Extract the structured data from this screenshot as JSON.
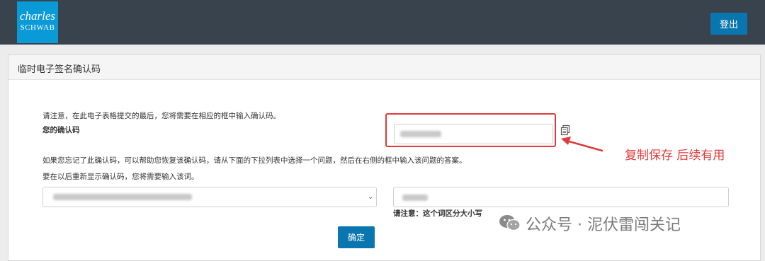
{
  "header": {
    "logo_line1": "charles",
    "logo_line2": "SCHWAB",
    "logout_label": "登出",
    "colors": {
      "bar": "#39434e",
      "logo": "#0b9ad8",
      "button": "#0a76b0"
    }
  },
  "panel": {
    "title": "临时电子签名确认码",
    "notice": "请注意，在此电子表格提交的最后，您将需要在相应的框中输入确认码。",
    "code_label": "您的确认码",
    "forgot_hint": "如果您忘记了此确认码，可以帮助您恢复该确认码，请从下面的下拉列表中选择一个问题，然后在右侧的框中输入该问题的答案。",
    "redisplay_hint": "要在以后重新显示确认码，您将需要输入该词。",
    "case_note": "请注意：这个词区分大小写",
    "confirm_label": "确定",
    "copy_icon": "copy-icon"
  },
  "annotation": {
    "text": "复制保存 后续有用",
    "color": "#e03a3a"
  },
  "watermark": {
    "text": "公众号 · 泥伏雷闯关记",
    "icon": "wechat-icon"
  }
}
